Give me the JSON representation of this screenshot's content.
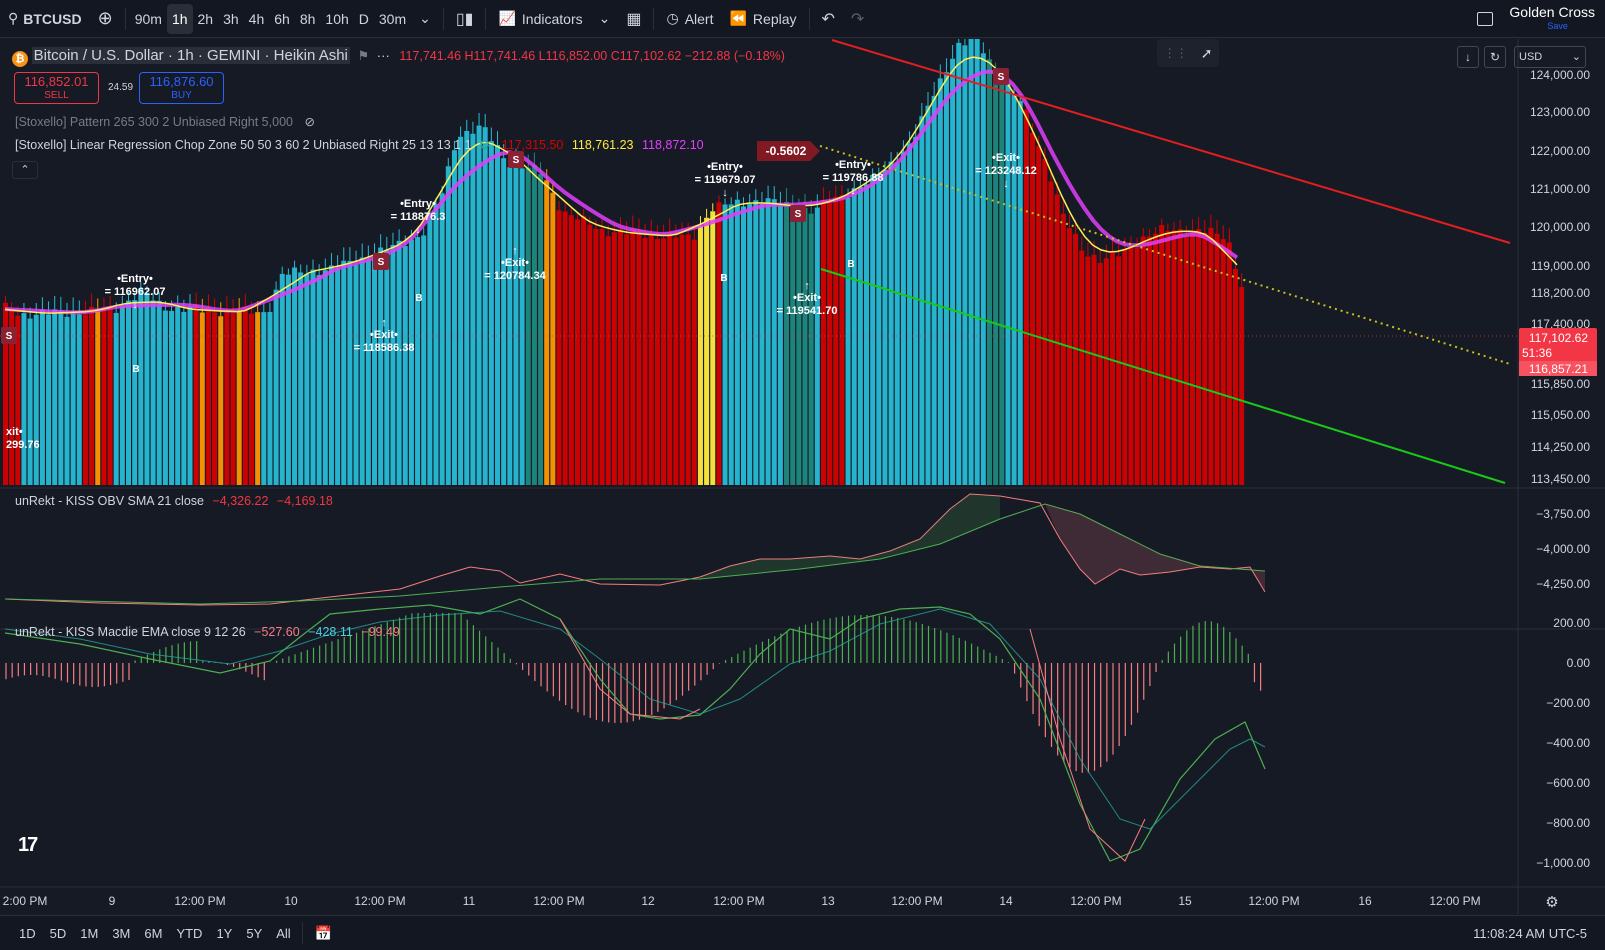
{
  "toolbar": {
    "symbol": "BTCUSD",
    "timeframes": [
      "90m",
      "1h",
      "2h",
      "3h",
      "4h",
      "6h",
      "8h",
      "10h",
      "D",
      "30m"
    ],
    "active_timeframe": "1h",
    "indicators_label": "Indicators",
    "alert_label": "Alert",
    "replay_label": "Replay",
    "layout_name": "Golden Cross",
    "save_label": "Save"
  },
  "legend": {
    "title": "Bitcoin / U.S. Dollar · 1h · GEMINI · Heikin Ashi",
    "ohlc": "117,741.46 H117,741.46 L116,852.00 C117,102.62 −212.88 (−0.18%)",
    "sell_price": "116,852.01",
    "sell_label": "SELL",
    "spread": "24.59",
    "buy_price": "116,876.60",
    "buy_label": "BUY",
    "indicator1": "[Stoxello] Pattern 265 300 2 Unbiased Right 5,000",
    "indicator2": "[Stoxello] Linear Regression Chop Zone 50 50 3 60 2 Unbiased Right 25 13 13 1 1",
    "ind2_val1": "117,315.50",
    "ind2_val2": "118,761.23",
    "ind2_val3": "118,872.10",
    "obv_label": "unRekt - KISS OBV SMA 21 close",
    "obv_val1": "−4,326.22",
    "obv_val2": "−4,169.18",
    "macd_label": "unRekt - KISS Macdie EMA close 9 12 26",
    "macd_val1": "−527.60",
    "macd_val2": "−428.11",
    "macd_val3": "−99.49"
  },
  "currency": "USD",
  "colors": {
    "bg": "#161a25",
    "bull": "#26bcd6",
    "bear": "#d60000",
    "chop_yellow": "#ffeb3b",
    "chop_orange": "#ff9800",
    "chop_green": "#1c8a80",
    "upper_trend": "#e21f1f",
    "lower_trend": "#18c918",
    "reg_dotted": "#c9c21a"
  },
  "price_axis": {
    "ticks": [
      "124,000.00",
      "123,000.00",
      "122,000.00",
      "121,000.00",
      "120,000.00",
      "119,000.00",
      "118,200.00",
      "117,400.00",
      "115,850.00",
      "115,050.00",
      "114,250.00",
      "113,450.00"
    ],
    "current_price": "117,102.62",
    "countdown": "51:36",
    "bid_price": "116,857.21"
  },
  "obv_axis": {
    "ticks": [
      "−3,750.00",
      "−4,000.00",
      "−4,250.00"
    ]
  },
  "macd_axis": {
    "ticks": [
      "200.00",
      "0.00",
      "−200.00",
      "−400.00",
      "−600.00",
      "−800.00",
      "−1,000.00"
    ]
  },
  "time_axis": {
    "labels": [
      "2:00 PM",
      "9",
      "12:00 PM",
      "10",
      "12:00 PM",
      "11",
      "12:00 PM",
      "12",
      "12:00 PM",
      "13",
      "12:00 PM",
      "14",
      "12:00 PM",
      "15",
      "12:00 PM",
      "16",
      "12:00 PM"
    ]
  },
  "annotations": {
    "entries": [
      {
        "label": "•Entry•",
        "value": "= 116962.07"
      },
      {
        "label": "•Entry•",
        "value": "= 118876.3"
      },
      {
        "label": "•Entry•",
        "value": "= 119679.07"
      },
      {
        "label": "•Entry•",
        "value": "= 119786.88"
      }
    ],
    "exits": [
      {
        "label": "•Exit•",
        "value": "= 118586.38"
      },
      {
        "label": "•Exit•",
        "value": "= 120784.34"
      },
      {
        "label": "•Exit•",
        "value": "= 119541.70"
      },
      {
        "label": "•Exit•",
        "value": "= 123248.12"
      },
      {
        "label": "xit•",
        "value": "299.76"
      }
    ],
    "slope_value": "-0.5602",
    "sell_mark": "S",
    "buy_mark": "B"
  },
  "ranges": [
    "1D",
    "5D",
    "1M",
    "3M",
    "6M",
    "YTD",
    "1Y",
    "5Y",
    "All"
  ],
  "clock": "11:08:24 AM UTC-5"
}
